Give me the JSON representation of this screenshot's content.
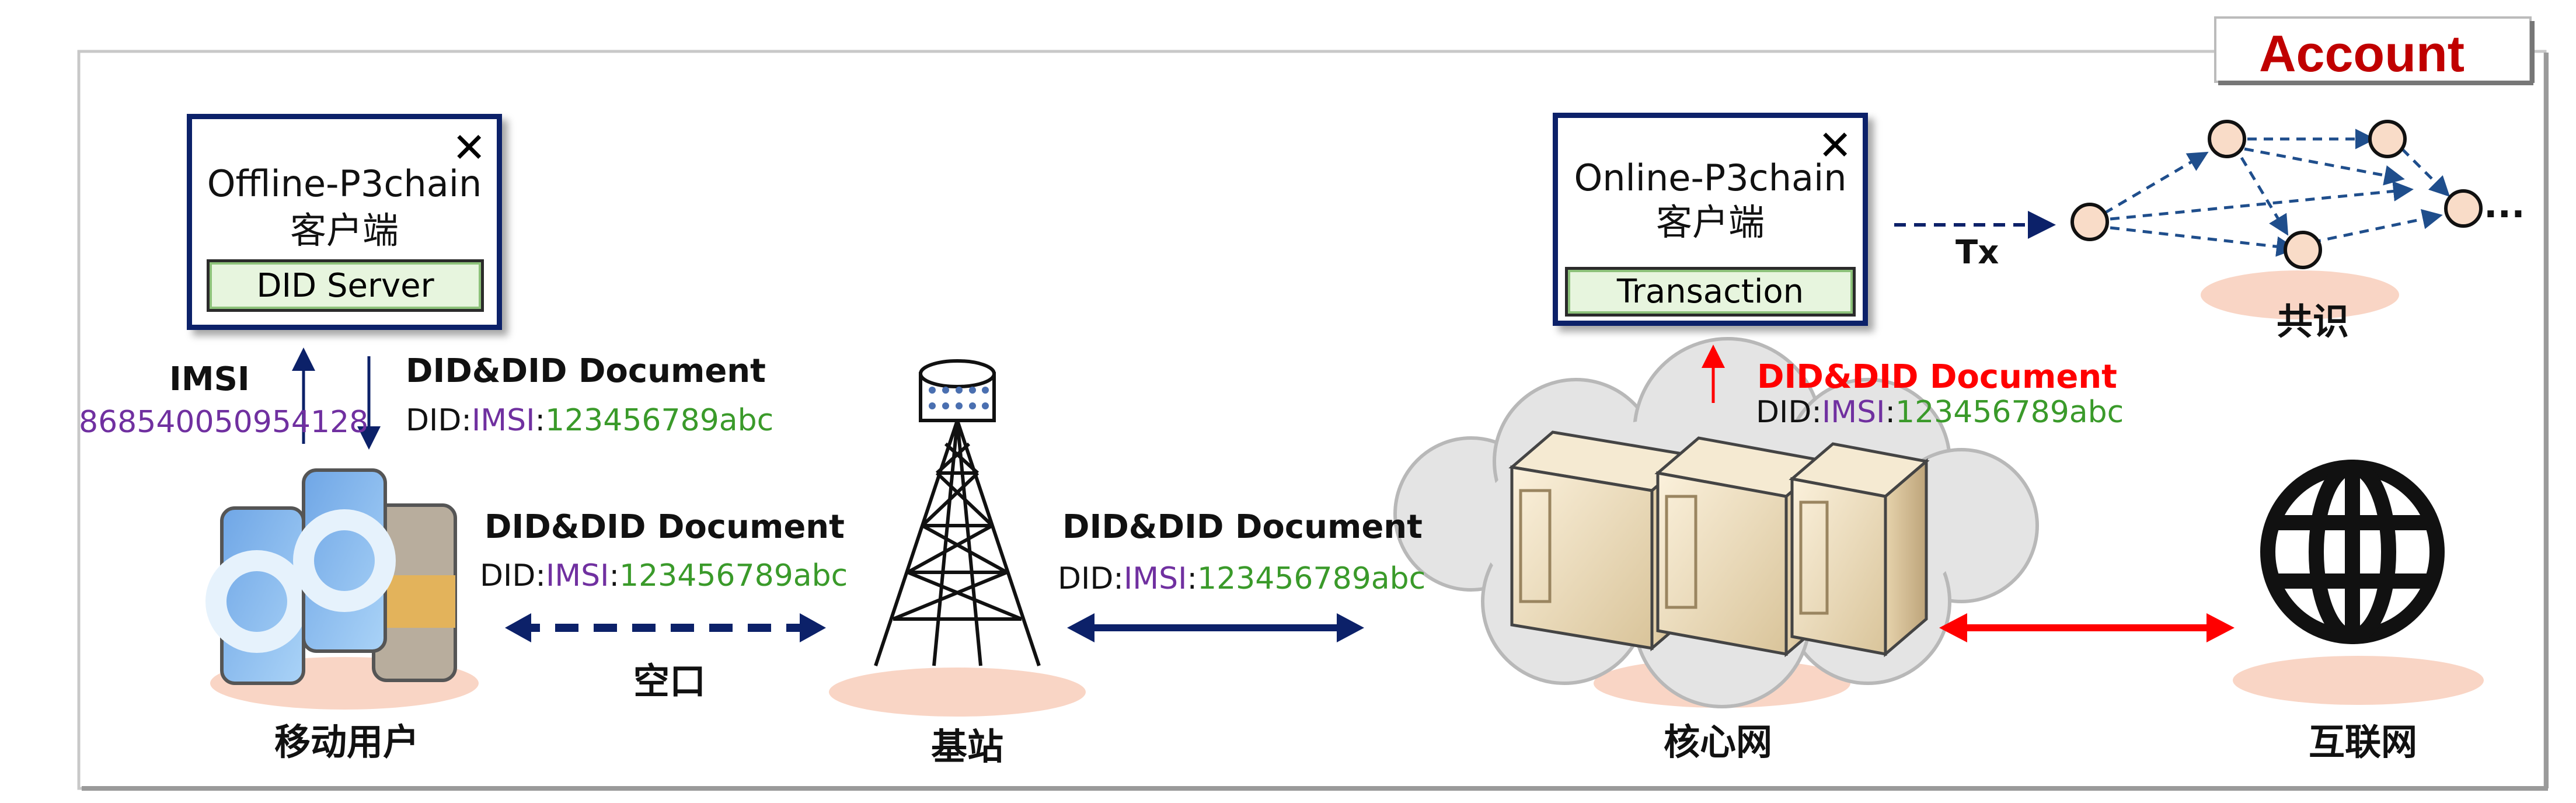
{
  "account_tab": {
    "label": "Account",
    "color": "#c00000"
  },
  "offline_panel": {
    "title": "Offline-P3chain",
    "subtitle": "客户端",
    "button_label": "DID Server",
    "close_glyph": "✕"
  },
  "online_panel": {
    "title": "Online-P3chain",
    "subtitle": "客户端",
    "button_label": "Transaction",
    "close_glyph": "✕"
  },
  "imsi": {
    "label": "IMSI",
    "value": "868540050954128"
  },
  "doc_device": {
    "title": "DID&DID Document",
    "did_prefix": "DID:",
    "did_type": "IMSI",
    "colon": ":",
    "did_value": "123456789abc"
  },
  "doc_air": {
    "title": "DID&DID Document",
    "did_prefix": "DID:",
    "did_type": "IMSI",
    "colon": ":",
    "did_value": "123456789abc"
  },
  "doc_backhaul": {
    "title": "DID&DID Document",
    "did_prefix": "DID:",
    "did_type": "IMSI",
    "colon": ":",
    "did_value": "123456789abc"
  },
  "doc_core": {
    "title": "DID&DID Document",
    "did_prefix": "DID:",
    "did_type": "IMSI",
    "colon": ":",
    "did_value": "123456789abc",
    "title_color": "#ff0000"
  },
  "labels": {
    "air_interface": "空口",
    "mobile_user": "移动用户",
    "base_station": "基站",
    "core_network": "核心网",
    "internet": "互联网",
    "consensus": "共识",
    "tx": "Tx",
    "ellipsis": "..."
  },
  "colors": {
    "navy": "#0c2169",
    "red": "#ff0000",
    "purple": "#7030a0",
    "green": "#3a9a2a",
    "node_fill": "#f9dcc8",
    "blob": "#f9d5c5"
  }
}
